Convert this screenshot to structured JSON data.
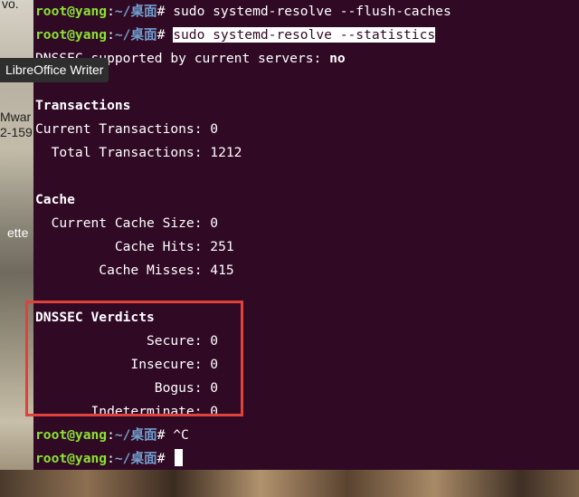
{
  "desktop": {
    "labels": {
      "top": "vo.",
      "mwar": "Mwar",
      "num": "2-159",
      "ette": "ette"
    }
  },
  "tooltip": {
    "text": "LibreOffice Writer"
  },
  "terminal": {
    "prompt": {
      "user_host": "root@yang",
      "sep": ":",
      "path": "~/桌面",
      "symbol": "# "
    },
    "lines": [
      {
        "kind": "cmd",
        "text": "sudo systemd-resolve --flush-caches"
      },
      {
        "kind": "cmd",
        "text": "sudo systemd-resolve --statistics",
        "selected": true
      },
      {
        "kind": "out",
        "label": "DNSSEC supported by current servers: ",
        "value": "no"
      },
      {
        "kind": "blank"
      },
      {
        "kind": "heading",
        "text": "Transactions"
      },
      {
        "kind": "out",
        "text": "Current Transactions: 0"
      },
      {
        "kind": "out",
        "text": "  Total Transactions: 1212"
      },
      {
        "kind": "blank"
      },
      {
        "kind": "heading",
        "text": "Cache"
      },
      {
        "kind": "out",
        "text": "  Current Cache Size: 0"
      },
      {
        "kind": "out",
        "text": "          Cache Hits: 251"
      },
      {
        "kind": "out",
        "text": "        Cache Misses: 415"
      },
      {
        "kind": "blank"
      },
      {
        "kind": "heading",
        "text": "DNSSEC Verdicts"
      },
      {
        "kind": "out",
        "text": "              Secure: 0"
      },
      {
        "kind": "out",
        "text": "            Insecure: 0"
      },
      {
        "kind": "out",
        "text": "               Bogus: 0"
      },
      {
        "kind": "out",
        "text": "       Indeterminate: 0"
      },
      {
        "kind": "cmd",
        "text": "^C"
      },
      {
        "kind": "cmd",
        "text": "",
        "cursor": true
      }
    ]
  },
  "colors": {
    "terminal_bg": "#300a24",
    "prompt_user": "#8ae234",
    "prompt_path": "#729fcf",
    "highlight": "#e0413a"
  }
}
